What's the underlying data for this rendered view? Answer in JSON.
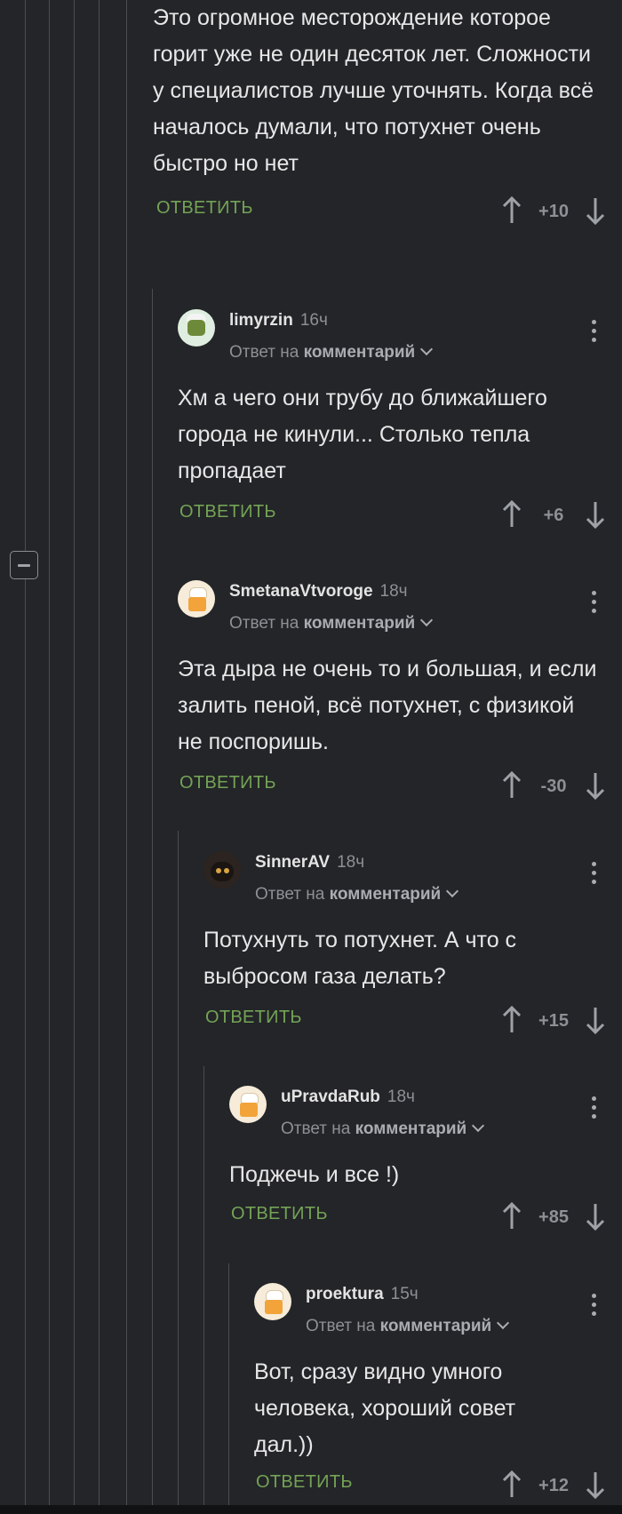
{
  "actions": {
    "reply_label": "ОТВЕТИТЬ",
    "reply_to_prefix": "Ответ на",
    "reply_to_target": "комментарий"
  },
  "colors": {
    "background": "#232528",
    "reply_green": "#74a356",
    "muted": "#8d9095"
  },
  "top_comment": {
    "body": "Это огромное месторождение которое горит уже не один десяток лет. Сложности у специалистов лучше уточнять. Когда всё началось думали, что потухнет очень быстро но нет",
    "score": "+10"
  },
  "comments": [
    {
      "username": "limyrzin",
      "time": "16ч",
      "body": "Хм а чего они трубу до ближайшего города не кинули... Столько тепла пропадает",
      "score": "+6",
      "avatar": "green-chef-avatar"
    },
    {
      "username": "SmetanaVtvoroge",
      "time": "18ч",
      "body": "Эта дыра не очень то и большая, и если залить пеной, всё потухнет, с физикой не поспоришь.",
      "score": "-30",
      "avatar": "chef-avatar"
    },
    {
      "username": "SinnerAV",
      "time": "18ч",
      "body": "Потухнуть то потухнет. А что с выбросом газа делать?",
      "score": "+15",
      "avatar": "cat-avatar"
    },
    {
      "username": "uPravdaRub",
      "time": "18ч",
      "body": "Поджечь и все !)",
      "score": "+85",
      "avatar": "chef-avatar"
    },
    {
      "username": "proektura",
      "time": "15ч",
      "body": "Вот, сразу видно умного человека, хороший совет дал.))",
      "score": "+12",
      "avatar": "chef-avatar"
    }
  ]
}
